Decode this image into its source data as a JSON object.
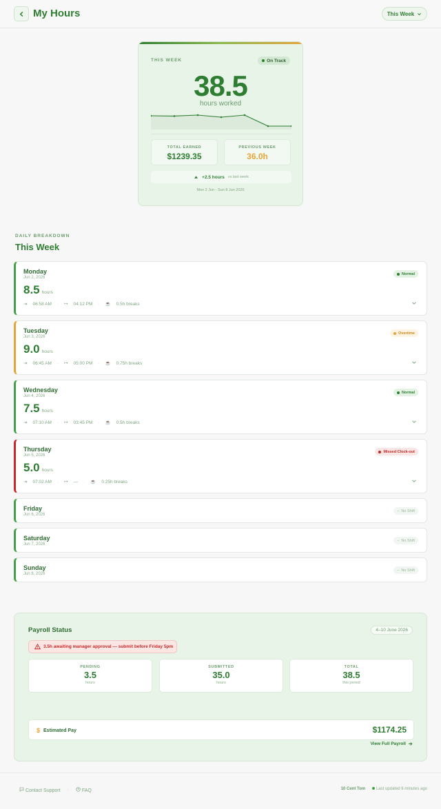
{
  "header": {
    "title": "My Hours",
    "period_label": "This Week"
  },
  "hero": {
    "label": "THIS WEEK",
    "status": "On Track",
    "hours": "38.5",
    "hours_unit": "hours worked",
    "trend": [
      8.5,
      8.3,
      9.0,
      7.5,
      9.0,
      1.0,
      1.0
    ],
    "total_earned_label": "TOTAL EARNED",
    "total_earned": "$1239.35",
    "previous_week_label": "PREVIOUS WEEK",
    "previous_week": "36.0h",
    "delta": "+2.5 hours",
    "delta_suffix": "vs last week",
    "range": "Mon 2 Jun - Sun 8 Jun 2026"
  },
  "breakdown": {
    "label": "DAILY BREAKDOWN",
    "title": "This Week",
    "days": [
      {
        "name": "Monday",
        "date": "Jun 2, 2026",
        "hours": "8.5",
        "unit": "hours",
        "clock_in": "06:58 AM",
        "clock_out": "04:12 PM",
        "breaks": "0.5h breaks",
        "status": "Normal"
      },
      {
        "name": "Tuesday",
        "date": "Jun 3, 2026",
        "hours": "9.0",
        "unit": "hours",
        "clock_in": "06:45 AM",
        "clock_out": "05:00 PM",
        "breaks": "0.75h breaks",
        "status": "Overtime"
      },
      {
        "name": "Wednesday",
        "date": "Jun 4, 2026",
        "hours": "7.5",
        "unit": "hours",
        "clock_in": "07:10 AM",
        "clock_out": "03:45 PM",
        "breaks": "0.5h breaks",
        "status": "Normal"
      },
      {
        "name": "Thursday",
        "date": "Jun 5, 2026",
        "hours": "5.0",
        "unit": "hours",
        "clock_in": "07:02 AM",
        "clock_out": "—",
        "breaks": "0.25h breaks",
        "status": "Missed Clock-out"
      },
      {
        "name": "Friday",
        "date": "Jun 6, 2026",
        "status": "No Shift"
      },
      {
        "name": "Saturday",
        "date": "Jun 7, 2026",
        "status": "No Shift"
      },
      {
        "name": "Sunday",
        "date": "Jun 8, 2026",
        "status": "No Shift"
      }
    ]
  },
  "payroll": {
    "title": "Payroll Status",
    "range": "4–10 June 2026",
    "alert": "3.5h awaiting manager approval — submit before Friday 5pm",
    "pending_label": "PENDING",
    "pending": "3.5",
    "pending_sub": "hours",
    "submitted_label": "SUBMITTED",
    "submitted": "35.0",
    "submitted_sub": "hours",
    "total_label": "TOTAL",
    "total": "38.5",
    "total_sub": "this period",
    "estimated_label": "Estimated Pay",
    "estimated": "$1174.25",
    "view_full": "View Full Payroll"
  },
  "footer": {
    "contact": "Contact Support",
    "faq": "FAQ",
    "brand": "10 Cent Tom",
    "updated": "Last updated 6 minutes ago"
  },
  "colors": {
    "accent": "#2e7d32",
    "overtime": "#e6a53a",
    "missed": "#c62828"
  }
}
